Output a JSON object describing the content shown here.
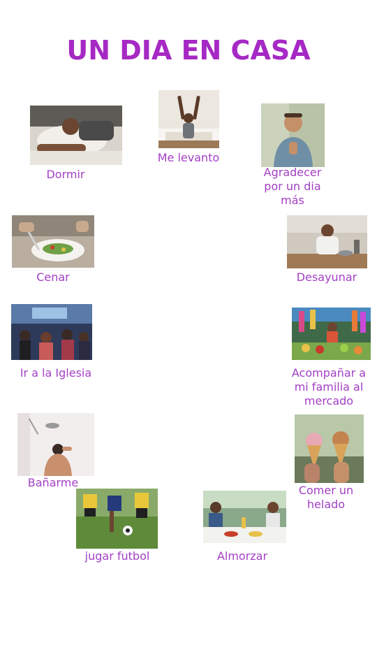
{
  "title": "UN DIA EN CASA",
  "accent_color": "#a629c4",
  "activities": {
    "dormir": {
      "label": "Dormir",
      "image": "man-sleeping-photo"
    },
    "levanto": {
      "label": "Me levanto",
      "image": "man-stretching-photo"
    },
    "agradecer": {
      "label": "Agradecer por un dia más",
      "image": "man-praying-photo"
    },
    "cenar": {
      "label": "Cenar",
      "image": "salad-dinner-photo"
    },
    "desayunar": {
      "label": "Desayunar",
      "image": "man-breakfast-photo"
    },
    "iglesia": {
      "label": "Ir a la Iglesia",
      "image": "church-congregation-photo"
    },
    "mercado": {
      "label": "Acompañar a mi familia al mercado",
      "image": "market-stall-photo"
    },
    "banarme": {
      "label": "Bañarme",
      "image": "shower-photo"
    },
    "helado": {
      "label": "Comer un helado",
      "image": "ice-cream-cones-photo"
    },
    "futbol": {
      "label": "jugar futbol",
      "image": "soccer-players-photo"
    },
    "almorzar": {
      "label": "Almorzar",
      "image": "family-lunch-photo"
    }
  }
}
